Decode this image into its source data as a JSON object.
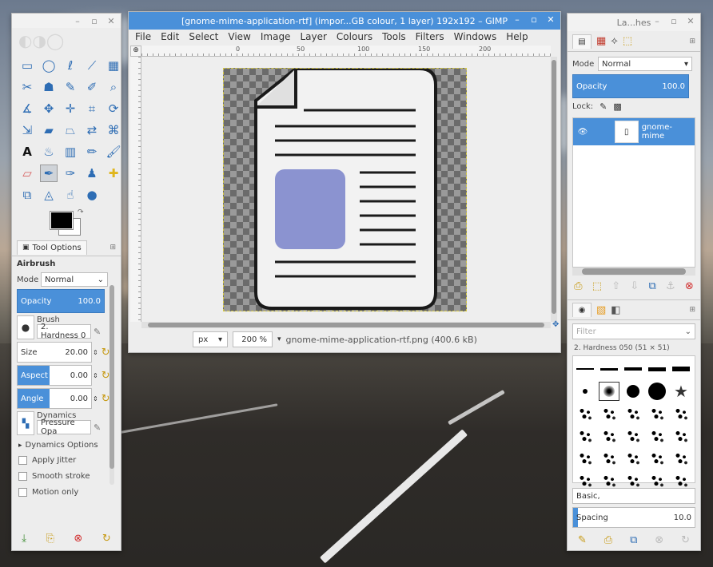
{
  "image_window": {
    "title": "[gnome-mime-application-rtf] (impor...GB colour, 1 layer) 192x192 – GIMP",
    "menu": [
      "File",
      "Edit",
      "Select",
      "View",
      "Image",
      "Layer",
      "Colours",
      "Tools",
      "Filters",
      "Windows",
      "Help"
    ],
    "ruler_marks": [
      "0",
      "50",
      "100",
      "150",
      "200"
    ],
    "status": {
      "unit": "px",
      "zoom": "200 %",
      "filename": "gnome-mime-application-rtf.png (400.6 kB)"
    }
  },
  "toolbox": {
    "tools": [
      {
        "name": "rect-select-icon",
        "glyph": "▭"
      },
      {
        "name": "ellipse-select-icon",
        "glyph": "◯"
      },
      {
        "name": "free-select-icon",
        "glyph": "ℓ"
      },
      {
        "name": "fuzzy-select-icon",
        "glyph": "⟋"
      },
      {
        "name": "select-by-color-icon",
        "glyph": "▦"
      },
      {
        "name": "scissors-icon",
        "glyph": "✂"
      },
      {
        "name": "foreground-select-icon",
        "glyph": "☗"
      },
      {
        "name": "paths-icon",
        "glyph": "✎"
      },
      {
        "name": "color-picker-icon",
        "glyph": "✐"
      },
      {
        "name": "zoom-icon",
        "glyph": "⌕"
      },
      {
        "name": "measure-icon",
        "glyph": "∡"
      },
      {
        "name": "move-icon",
        "glyph": "✥"
      },
      {
        "name": "align-icon",
        "glyph": "✛"
      },
      {
        "name": "crop-icon",
        "glyph": "⌗"
      },
      {
        "name": "rotate-icon",
        "glyph": "⟳"
      },
      {
        "name": "scale-icon",
        "glyph": "⇲"
      },
      {
        "name": "shear-icon",
        "glyph": "▰"
      },
      {
        "name": "perspective-icon",
        "glyph": "⏢"
      },
      {
        "name": "flip-icon",
        "glyph": "⇄"
      },
      {
        "name": "cage-icon",
        "glyph": "⌘"
      },
      {
        "name": "text-icon",
        "glyph": "A"
      },
      {
        "name": "bucket-fill-icon",
        "glyph": "♨"
      },
      {
        "name": "blend-icon",
        "glyph": "▥"
      },
      {
        "name": "pencil-icon",
        "glyph": "✏"
      },
      {
        "name": "paintbrush-icon",
        "glyph": "🖌"
      },
      {
        "name": "eraser-icon",
        "glyph": "▱"
      },
      {
        "name": "airbrush-icon",
        "glyph": "✒"
      },
      {
        "name": "ink-icon",
        "glyph": "✑"
      },
      {
        "name": "clone-icon",
        "glyph": "♟"
      },
      {
        "name": "heal-icon",
        "glyph": "✚"
      },
      {
        "name": "perspective-clone-icon",
        "glyph": "⧉"
      },
      {
        "name": "blur-icon",
        "glyph": "◬"
      },
      {
        "name": "smudge-icon",
        "glyph": "☝"
      },
      {
        "name": "dodge-burn-icon",
        "glyph": "●"
      }
    ],
    "colors": {
      "fg": "#000000",
      "bg": "#ffffff"
    }
  },
  "tool_options": {
    "tab_label": "Tool Options",
    "tool_name": "Airbrush",
    "mode_label": "Mode",
    "mode_value": "Normal",
    "opacity_label": "Opacity",
    "opacity_value": "100.0",
    "brush_label": "Brush",
    "brush_value": "2. Hardness 0",
    "size_label": "Size",
    "size_value": "20.00",
    "aspect_label": "Aspect",
    "aspect_value": "0.00",
    "angle_label": "Angle",
    "angle_value": "0.00",
    "dynamics_label": "Dynamics",
    "dynamics_value": "Pressure Opa",
    "dynamics_options": "Dynamics Options",
    "apply_jitter": "Apply Jitter",
    "smooth_stroke": "Smooth stroke",
    "motion_only": "Motion only"
  },
  "layers_dock": {
    "title": "La...hes",
    "mode_label": "Mode",
    "mode_value": "Normal",
    "opacity_label": "Opacity",
    "opacity_value": "100.0",
    "lock_label": "Lock:",
    "layer_name": "gnome-mime",
    "filter_placeholder": "Filter",
    "brush_title": "2. Hardness 050 (51 × 51)",
    "brush_set": "Basic,",
    "spacing_label": "Spacing",
    "spacing_value": "10.0"
  }
}
